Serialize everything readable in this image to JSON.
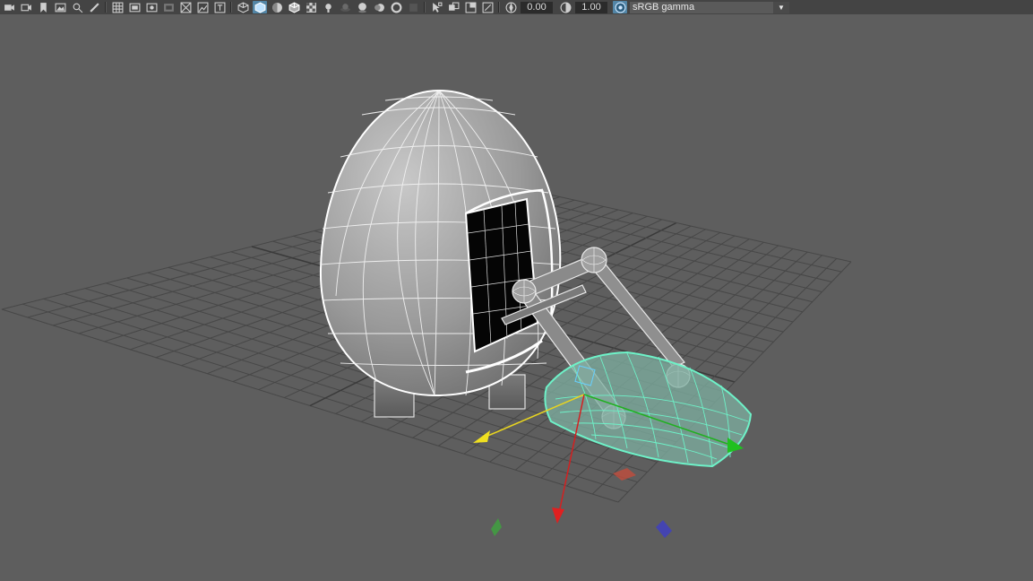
{
  "toolbar": {
    "exposure_value": "0.00",
    "gamma_value": "1.00",
    "color_space": "sRGB gamma",
    "colors": {
      "bg": "#444444",
      "active": "#5285a6"
    }
  },
  "viewport": {
    "background": "#5e5e5e",
    "objects": [
      "egg-pod",
      "mechanical-arm",
      "hatch-door",
      "transform-manipulator",
      "grid"
    ],
    "selection_color": "#6ef2c8",
    "axis_colors": {
      "x": "#d42020",
      "y": "#e8d420",
      "z": "#20b020"
    }
  }
}
